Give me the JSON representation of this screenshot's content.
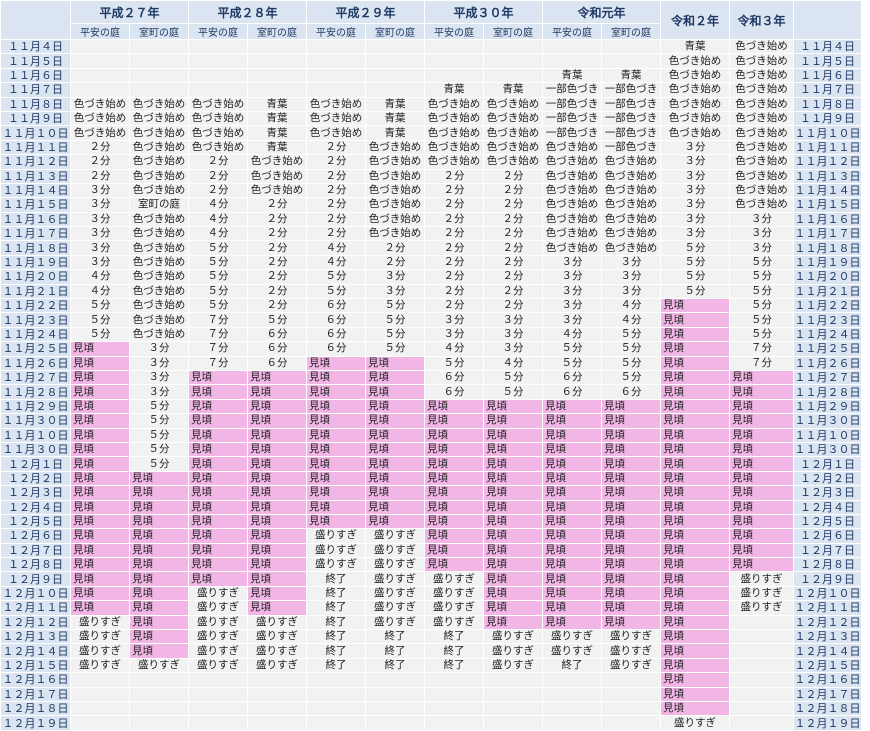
{
  "colors": {
    "header_bg": "#dbe5f1",
    "cell_bg": "#f2f2f2",
    "peak_bg": "#f2b6e6",
    "header_text": "#1f3864"
  },
  "header": {
    "years": [
      "平成２７年",
      "平成２８年",
      "平成２９年",
      "平成３０年",
      "令和元年",
      "令和２年",
      "令和３年"
    ],
    "gardens": [
      "平安の庭",
      "室町の庭"
    ]
  },
  "peak_label": "見頃",
  "rows": [
    {
      "date": "１１月４日",
      "cells": [
        "",
        "",
        "",
        "",
        "",
        "",
        "",
        "",
        "",
        "",
        "青葉",
        "色づき始め"
      ]
    },
    {
      "date": "１１月５日",
      "cells": [
        "",
        "",
        "",
        "",
        "",
        "",
        "",
        "",
        "",
        "",
        "色づき始め",
        "色づき始め"
      ]
    },
    {
      "date": "１１月６日",
      "cells": [
        "",
        "",
        "",
        "",
        "",
        "",
        "",
        "",
        "青葉",
        "青葉",
        "色づき始め",
        "色づき始め"
      ]
    },
    {
      "date": "１１月７日",
      "cells": [
        "",
        "",
        "",
        "",
        "",
        "",
        "青葉",
        "青葉",
        "一部色づき",
        "一部色づき",
        "色づき始め",
        "色づき始め"
      ]
    },
    {
      "date": "１１月８日",
      "cells": [
        "色づき始め",
        "色づき始め",
        "色づき始め",
        "青葉",
        "色づき始め",
        "青葉",
        "色づき始め",
        "色づき始め",
        "一部色づき",
        "一部色づき",
        "色づき始め",
        "色づき始め"
      ]
    },
    {
      "date": "１１月９日",
      "cells": [
        "色づき始め",
        "色づき始め",
        "色づき始め",
        "青葉",
        "色づき始め",
        "青葉",
        "色づき始め",
        "色づき始め",
        "一部色づき",
        "一部色づき",
        "色づき始め",
        "色づき始め"
      ]
    },
    {
      "date": "１１月１０日",
      "cells": [
        "色づき始め",
        "色づき始め",
        "色づき始め",
        "青葉",
        "色づき始め",
        "青葉",
        "色づき始め",
        "色づき始め",
        "一部色づき",
        "一部色づき",
        "色づき始め",
        "色づき始め"
      ]
    },
    {
      "date": "１１月１１日",
      "cells": [
        "２分",
        "色づき始め",
        "色づき始め",
        "青葉",
        "２分",
        "色づき始め",
        "色づき始め",
        "色づき始め",
        "色づき始め",
        "一部色づき",
        "３分",
        "色づき始め"
      ]
    },
    {
      "date": "１１月１２日",
      "cells": [
        "２分",
        "色づき始め",
        "２分",
        "色づき始め",
        "２分",
        "色づき始め",
        "色づき始め",
        "色づき始め",
        "色づき始め",
        "色づき始め",
        "３分",
        "色づき始め"
      ]
    },
    {
      "date": "１１月１３日",
      "cells": [
        "２分",
        "色づき始め",
        "２分",
        "色づき始め",
        "２分",
        "色づき始め",
        "２分",
        "２分",
        "色づき始め",
        "色づき始め",
        "３分",
        "色づき始め"
      ]
    },
    {
      "date": "１１月１４日",
      "cells": [
        "３分",
        "色づき始め",
        "２分",
        "色づき始め",
        "２分",
        "色づき始め",
        "２分",
        "２分",
        "色づき始め",
        "色づき始め",
        "３分",
        "色づき始め"
      ]
    },
    {
      "date": "１１月１５日",
      "cells": [
        "３分",
        "室町の庭",
        "４分",
        "２分",
        "２分",
        "色づき始め",
        "２分",
        "２分",
        "色づき始め",
        "色づき始め",
        "３分",
        "色づき始め"
      ]
    },
    {
      "date": "１１月１６日",
      "cells": [
        "３分",
        "色づき始め",
        "４分",
        "２分",
        "２分",
        "色づき始め",
        "２分",
        "２分",
        "色づき始め",
        "色づき始め",
        "３分",
        "３分"
      ]
    },
    {
      "date": "１１月１７日",
      "cells": [
        "３分",
        "色づき始め",
        "４分",
        "２分",
        "２分",
        "色づき始め",
        "２分",
        "２分",
        "色づき始め",
        "色づき始め",
        "３分",
        "３分"
      ]
    },
    {
      "date": "１１月１８日",
      "cells": [
        "３分",
        "色づき始め",
        "５分",
        "２分",
        "４分",
        "２分",
        "２分",
        "２分",
        "色づき始め",
        "色づき始め",
        "５分",
        "３分"
      ]
    },
    {
      "date": "１１月１９日",
      "cells": [
        "３分",
        "色づき始め",
        "５分",
        "２分",
        "４分",
        "２分",
        "２分",
        "２分",
        "３分",
        "３分",
        "５分",
        "５分"
      ]
    },
    {
      "date": "１１月２０日",
      "cells": [
        "４分",
        "色づき始め",
        "５分",
        "２分",
        "５分",
        "３分",
        "２分",
        "２分",
        "３分",
        "３分",
        "５分",
        "５分"
      ]
    },
    {
      "date": "１１月２１日",
      "cells": [
        "４分",
        "色づき始め",
        "５分",
        "２分",
        "５分",
        "３分",
        "２分",
        "２分",
        "３分",
        "３分",
        "５分",
        "５分"
      ]
    },
    {
      "date": "１１月２２日",
      "cells": [
        "５分",
        "色づき始め",
        "５分",
        "２分",
        "６分",
        "５分",
        "２分",
        "２分",
        "３分",
        "４分",
        "見頃",
        "５分"
      ]
    },
    {
      "date": "１１月２３日",
      "cells": [
        "５分",
        "色づき始め",
        "７分",
        "５分",
        "６分",
        "５分",
        "３分",
        "３分",
        "３分",
        "４分",
        "見頃",
        "５分"
      ]
    },
    {
      "date": "１１月２４日",
      "cells": [
        "５分",
        "色づき始め",
        "７分",
        "６分",
        "６分",
        "５分",
        "３分",
        "３分",
        "４分",
        "５分",
        "見頃",
        "５分"
      ]
    },
    {
      "date": "１１月２５日",
      "cells": [
        "見頃",
        "３分",
        "７分",
        "６分",
        "６分",
        "５分",
        "４分",
        "３分",
        "５分",
        "５分",
        "見頃",
        "７分"
      ]
    },
    {
      "date": "１１月２６日",
      "cells": [
        "見頃",
        "３分",
        "７分",
        "６分",
        "見頃",
        "見頃",
        "５分",
        "４分",
        "５分",
        "５分",
        "見頃",
        "７分"
      ]
    },
    {
      "date": "１１月２７日",
      "cells": [
        "見頃",
        "３分",
        "見頃",
        "見頃",
        "見頃",
        "見頃",
        "６分",
        "５分",
        "６分",
        "５分",
        "見頃",
        "見頃"
      ]
    },
    {
      "date": "１１月２８日",
      "cells": [
        "見頃",
        "３分",
        "見頃",
        "見頃",
        "見頃",
        "見頃",
        "６分",
        "５分",
        "６分",
        "６分",
        "見頃",
        "見頃"
      ]
    },
    {
      "date": "１１月２９日",
      "cells": [
        "見頃",
        "５分",
        "見頃",
        "見頃",
        "見頃",
        "見頃",
        "見頃",
        "見頃",
        "見頃",
        "見頃",
        "見頃",
        "見頃"
      ]
    },
    {
      "date": "１１月３０日",
      "cells": [
        "見頃",
        "５分",
        "見頃",
        "見頃",
        "見頃",
        "見頃",
        "見頃",
        "見頃",
        "見頃",
        "見頃",
        "見頃",
        "見頃"
      ]
    },
    {
      "date": "１１月１０日",
      "cells": [
        "見頃",
        "５分",
        "見頃",
        "見頃",
        "見頃",
        "見頃",
        "見頃",
        "見頃",
        "見頃",
        "見頃",
        "見頃",
        "見頃"
      ]
    },
    {
      "date": "１１月３０日",
      "cells": [
        "見頃",
        "５分",
        "見頃",
        "見頃",
        "見頃",
        "見頃",
        "見頃",
        "見頃",
        "見頃",
        "見頃",
        "見頃",
        "見頃"
      ]
    },
    {
      "date": "１２月１日",
      "cells": [
        "見頃",
        "５分",
        "見頃",
        "見頃",
        "見頃",
        "見頃",
        "見頃",
        "見頃",
        "見頃",
        "見頃",
        "見頃",
        "見頃"
      ]
    },
    {
      "date": "１２月２日",
      "cells": [
        "見頃",
        "見頃",
        "見頃",
        "見頃",
        "見頃",
        "見頃",
        "見頃",
        "見頃",
        "見頃",
        "見頃",
        "見頃",
        "見頃"
      ]
    },
    {
      "date": "１２月３日",
      "cells": [
        "見頃",
        "見頃",
        "見頃",
        "見頃",
        "見頃",
        "見頃",
        "見頃",
        "見頃",
        "見頃",
        "見頃",
        "見頃",
        "見頃"
      ]
    },
    {
      "date": "１２月４日",
      "cells": [
        "見頃",
        "見頃",
        "見頃",
        "見頃",
        "見頃",
        "見頃",
        "見頃",
        "見頃",
        "見頃",
        "見頃",
        "見頃",
        "見頃"
      ]
    },
    {
      "date": "１２月５日",
      "cells": [
        "見頃",
        "見頃",
        "見頃",
        "見頃",
        "見頃",
        "見頃",
        "見頃",
        "見頃",
        "見頃",
        "見頃",
        "見頃",
        "見頃"
      ]
    },
    {
      "date": "１２月６日",
      "cells": [
        "見頃",
        "見頃",
        "見頃",
        "見頃",
        "盛りすぎ",
        "盛りすぎ",
        "見頃",
        "見頃",
        "見頃",
        "見頃",
        "見頃",
        "見頃"
      ]
    },
    {
      "date": "１２月７日",
      "cells": [
        "見頃",
        "見頃",
        "見頃",
        "見頃",
        "盛りすぎ",
        "盛りすぎ",
        "見頃",
        "見頃",
        "見頃",
        "見頃",
        "見頃",
        "見頃"
      ]
    },
    {
      "date": "１２月８日",
      "cells": [
        "見頃",
        "見頃",
        "見頃",
        "見頃",
        "盛りすぎ",
        "盛りすぎ",
        "見頃",
        "見頃",
        "見頃",
        "見頃",
        "見頃",
        "見頃"
      ]
    },
    {
      "date": "１２月９日",
      "cells": [
        "見頃",
        "見頃",
        "見頃",
        "見頃",
        "終了",
        "盛りすぎ",
        "盛りすぎ",
        "見頃",
        "見頃",
        "見頃",
        "見頃",
        "盛りすぎ"
      ]
    },
    {
      "date": "１２月１０日",
      "cells": [
        "見頃",
        "見頃",
        "盛りすぎ",
        "見頃",
        "終了",
        "盛りすぎ",
        "盛りすぎ",
        "見頃",
        "見頃",
        "見頃",
        "見頃",
        "盛りすぎ"
      ]
    },
    {
      "date": "１２月１１日",
      "cells": [
        "見頃",
        "見頃",
        "盛りすぎ",
        "見頃",
        "終了",
        "盛りすぎ",
        "盛りすぎ",
        "見頃",
        "見頃",
        "見頃",
        "見頃",
        "盛りすぎ"
      ]
    },
    {
      "date": "１２月１２日",
      "cells": [
        "盛りすぎ",
        "見頃",
        "盛りすぎ",
        "盛りすぎ",
        "終了",
        "盛りすぎ",
        "盛りすぎ",
        "見頃",
        "見頃",
        "見頃",
        "見頃",
        ""
      ]
    },
    {
      "date": "１２月１３日",
      "cells": [
        "盛りすぎ",
        "見頃",
        "盛りすぎ",
        "盛りすぎ",
        "終了",
        "終了",
        "終了",
        "盛りすぎ",
        "盛りすぎ",
        "盛りすぎ",
        "見頃",
        ""
      ]
    },
    {
      "date": "１２月１４日",
      "cells": [
        "盛りすぎ",
        "見頃",
        "盛りすぎ",
        "盛りすぎ",
        "終了",
        "終了",
        "終了",
        "盛りすぎ",
        "盛りすぎ",
        "盛りすぎ",
        "見頃",
        ""
      ]
    },
    {
      "date": "１２月１５日",
      "cells": [
        "盛りすぎ",
        "盛りすぎ",
        "盛りすぎ",
        "盛りすぎ",
        "終了",
        "終了",
        "終了",
        "盛りすぎ",
        "終了",
        "盛りすぎ",
        "見頃",
        ""
      ]
    },
    {
      "date": "１２月１６日",
      "cells": [
        "",
        "",
        "",
        "",
        "",
        "",
        "",
        "",
        "",
        "",
        "見頃",
        ""
      ]
    },
    {
      "date": "１２月１７日",
      "cells": [
        "",
        "",
        "",
        "",
        "",
        "",
        "",
        "",
        "",
        "",
        "見頃",
        ""
      ]
    },
    {
      "date": "１２月１８日",
      "cells": [
        "",
        "",
        "",
        "",
        "",
        "",
        "",
        "",
        "",
        "",
        "見頃",
        ""
      ]
    },
    {
      "date": "１２月１９日",
      "cells": [
        "",
        "",
        "",
        "",
        "",
        "",
        "",
        "",
        "",
        "",
        "盛りすぎ",
        ""
      ]
    }
  ]
}
